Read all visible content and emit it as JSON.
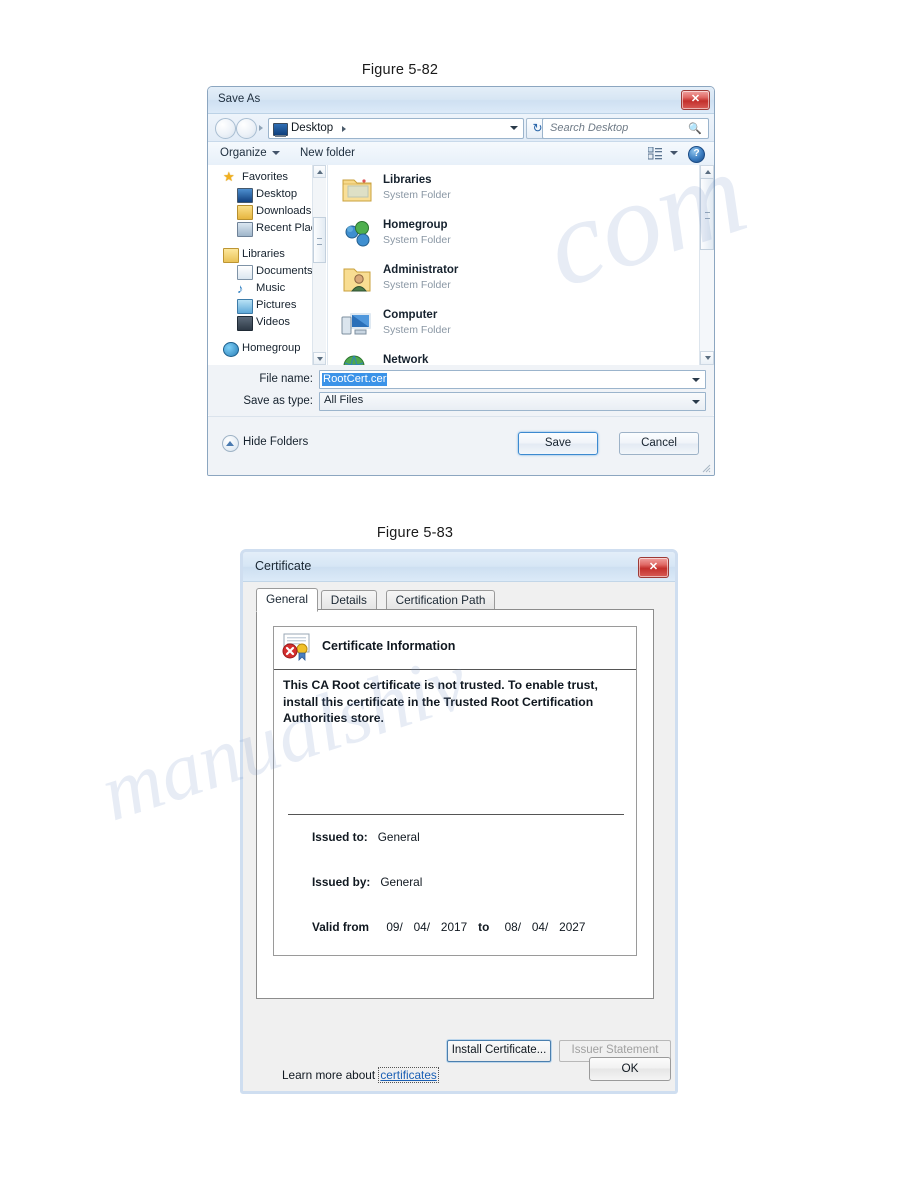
{
  "figures": {
    "fig82_caption": "Figure 5-82",
    "fig83_caption": "Figure 5-83"
  },
  "save_as_dialog": {
    "title": "Save As",
    "close_label": "✕",
    "address": {
      "current_location": "Desktop",
      "crumb_arrow": "▸"
    },
    "refresh_label": "↻",
    "search": {
      "placeholder": "Search Desktop",
      "icon": "search-icon"
    },
    "toolbar": {
      "organize_label": "Organize",
      "new_folder_label": "New folder",
      "help_label": "?"
    },
    "nav_tree": [
      {
        "label": "Favorites",
        "level": "root",
        "icon": "star-icon"
      },
      {
        "label": "Desktop",
        "level": "child",
        "icon": "monitor-icon"
      },
      {
        "label": "Downloads",
        "level": "child",
        "icon": "download-folder-icon"
      },
      {
        "label": "Recent Places",
        "level": "child",
        "icon": "recent-places-icon"
      },
      {
        "label": "",
        "level": "spacer",
        "icon": ""
      },
      {
        "label": "Libraries",
        "level": "root",
        "icon": "library-folder-icon"
      },
      {
        "label": "Documents",
        "level": "child",
        "icon": "documents-icon"
      },
      {
        "label": "Music",
        "level": "child",
        "icon": "music-note-icon"
      },
      {
        "label": "Pictures",
        "level": "child",
        "icon": "picture-icon"
      },
      {
        "label": "Videos",
        "level": "child",
        "icon": "video-icon"
      },
      {
        "label": "",
        "level": "spacer",
        "icon": ""
      },
      {
        "label": "Homegroup",
        "level": "root",
        "icon": "homegroup-icon"
      }
    ],
    "file_list": [
      {
        "name": "Libraries",
        "type": "System Folder",
        "icon": "library-folder-icon"
      },
      {
        "name": "Homegroup",
        "type": "System Folder",
        "icon": "homegroup-icon"
      },
      {
        "name": "Administrator",
        "type": "System Folder",
        "icon": "user-folder-icon"
      },
      {
        "name": "Computer",
        "type": "System Folder",
        "icon": "computer-icon"
      },
      {
        "name": "Network",
        "type": "",
        "icon": "network-icon"
      }
    ],
    "form": {
      "file_name_label": "File name:",
      "file_name_value": "RootCert.cer",
      "save_as_type_label": "Save as type:",
      "save_as_type_value": "All Files"
    },
    "footer": {
      "hide_folders_label": "Hide Folders",
      "save_label": "Save",
      "cancel_label": "Cancel"
    }
  },
  "certificate_dialog": {
    "title": "Certificate",
    "close_label": "✕",
    "tabs": [
      {
        "label": "General",
        "active": true
      },
      {
        "label": "Details",
        "active": false
      },
      {
        "label": "Certification Path",
        "active": false
      }
    ],
    "info_title": "Certificate Information",
    "warning_text": "This CA Root certificate is not trusted. To enable trust, install this certificate in the Trusted Root Certification Authorities store.",
    "fields": {
      "issued_to_label": "Issued to:",
      "issued_to_value": "General",
      "issued_by_label": "Issued by:",
      "issued_by_value": "General",
      "valid_from_label": "Valid from",
      "valid_from_month": "09/",
      "valid_from_day": "04/",
      "valid_from_year": "2017",
      "valid_to_word": "to",
      "valid_to_month": "08/",
      "valid_to_day": "04/",
      "valid_to_year": "2027"
    },
    "buttons": {
      "install_certificate": "Install Certificate...",
      "issuer_statement": "Issuer Statement",
      "ok": "OK"
    },
    "learn_more_prefix": "Learn more about ",
    "learn_more_link": "certificates"
  },
  "watermark": {
    "line1": "com",
    "line2": "manualshiv"
  },
  "colors": {
    "title_bar": "#d7e6f4",
    "close_button_red": "#c32f2b",
    "selection_blue": "#3b93e8",
    "link_blue": "#1a5fb4",
    "focus_border": "#3c8ad0"
  }
}
